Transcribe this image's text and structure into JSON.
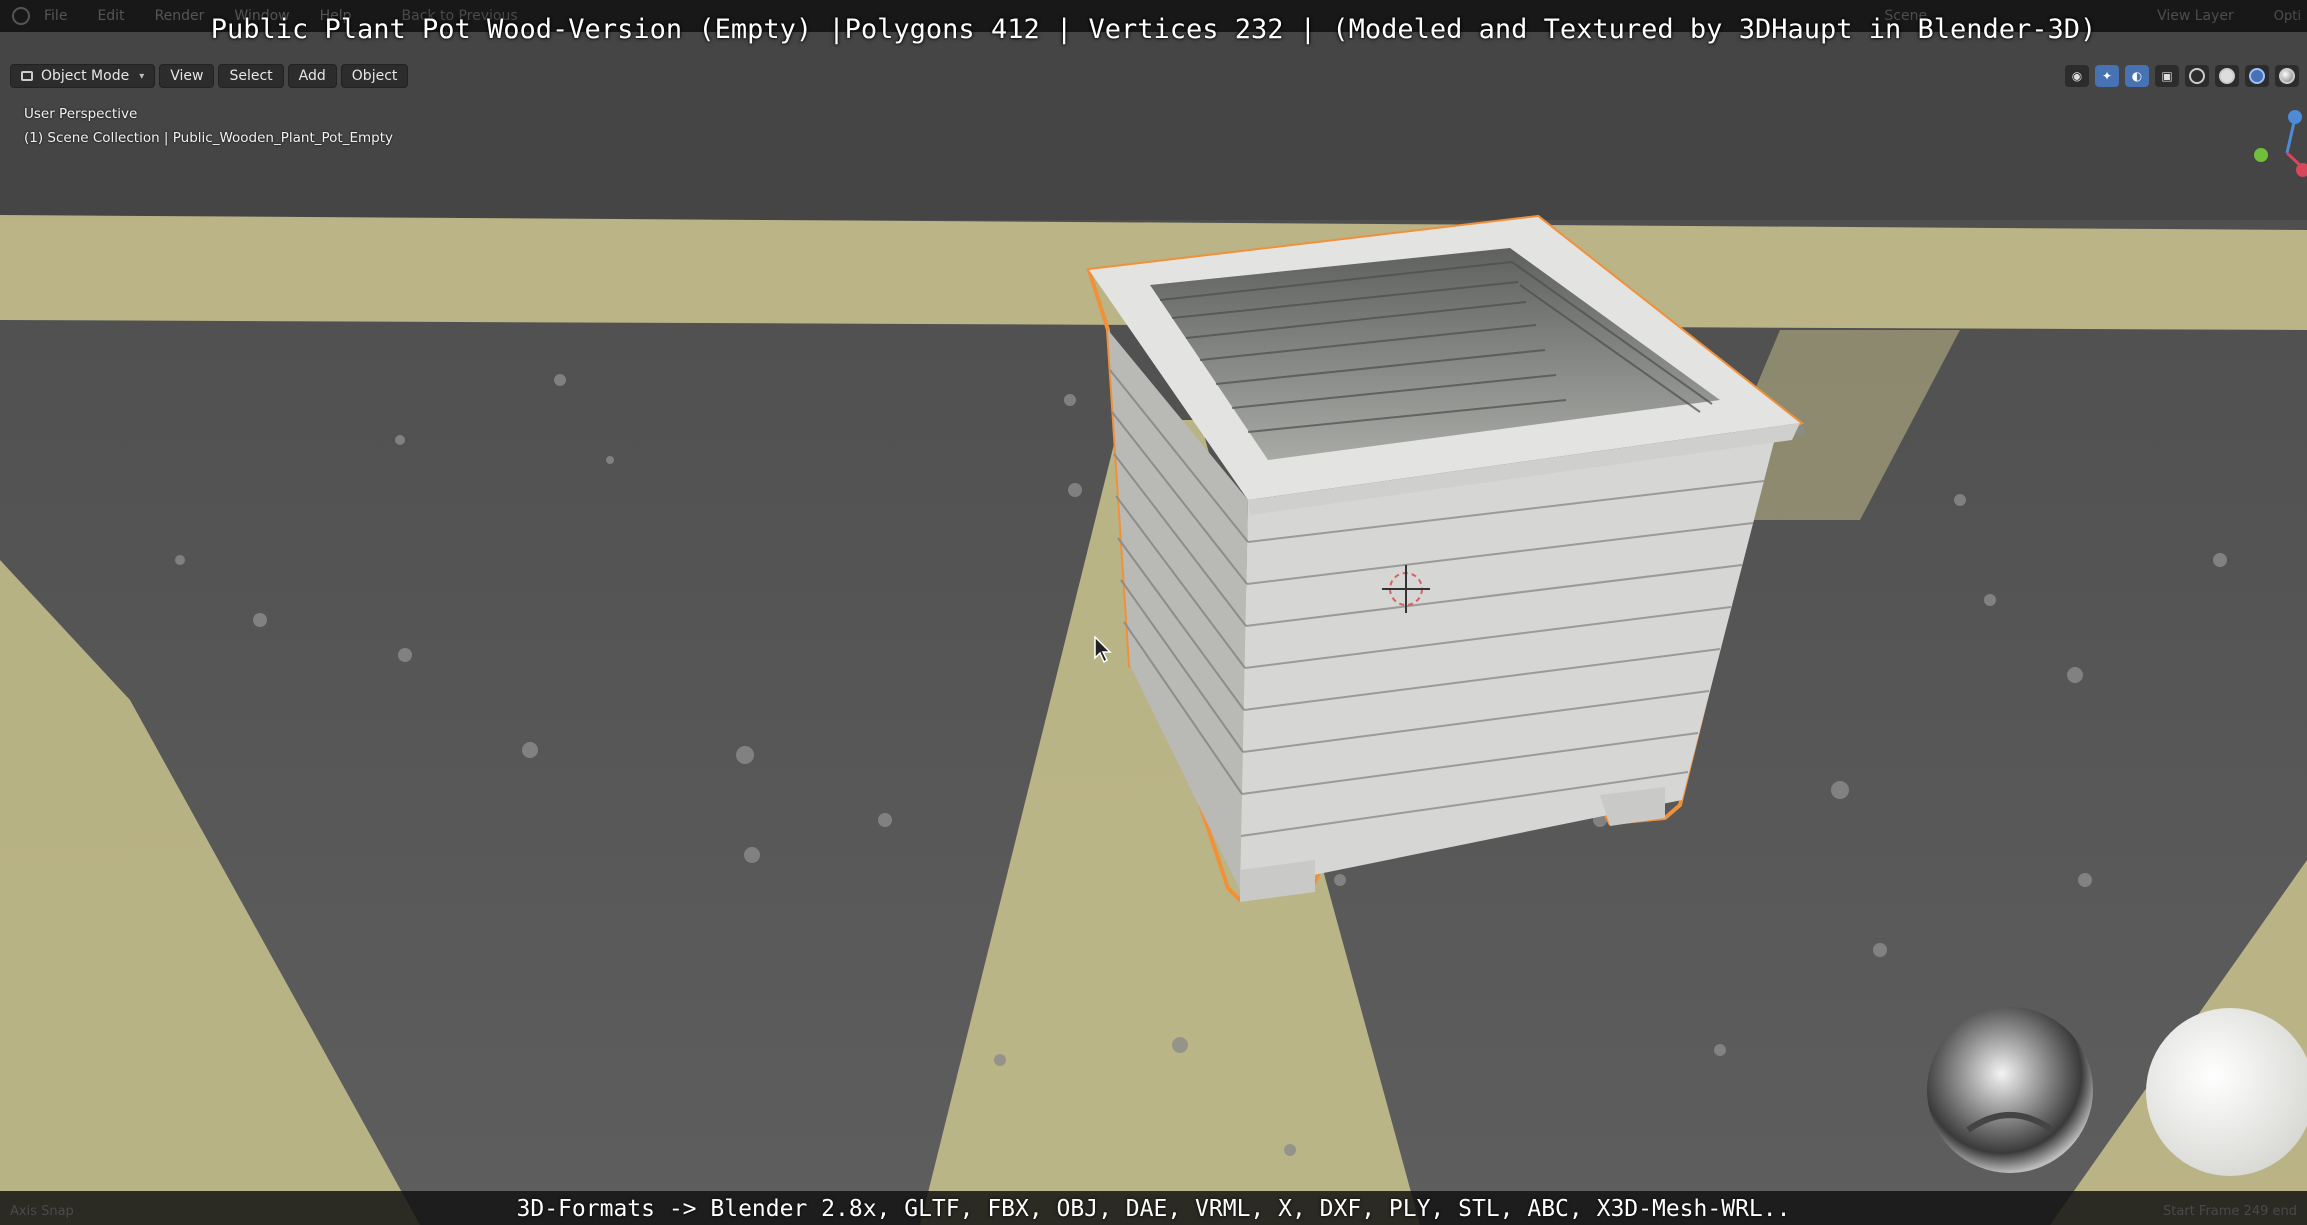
{
  "menubar": {
    "items": [
      "File",
      "Edit",
      "Render",
      "Window",
      "Help"
    ],
    "back_label": "Back to Previous",
    "scene_label": "Scene",
    "view_layer_label": "View Layer",
    "options_label": "Opti"
  },
  "overlay": {
    "title": "Public Plant Pot Wood-Version (Empty) |Polygons 412 | Vertices 232 | (Modeled and Textured by 3DHaupt in Blender-3D)",
    "caption": "3D-Formats -> Blender 2.8x, GLTF, FBX, OBJ, DAE, VRML, X, DXF, PLY, STL, ABC, X3D-Mesh-WRL.."
  },
  "header": {
    "mode": "Object Mode",
    "view": "View",
    "select": "Select",
    "add": "Add",
    "object": "Object"
  },
  "viewport_info": {
    "perspective": "User Perspective",
    "collection": "(1) Scene Collection | Public_Wooden_Plant_Pot_Empty"
  },
  "statusbar": {
    "left": "Axis Snap",
    "right": "Start Frame 249 end"
  },
  "colors": {
    "selection_outline": "#f0913a",
    "ground_yellow": "#c7c08a",
    "ground_gray": "#5a5a5a",
    "pot_white": "#d8d8d6"
  },
  "icons": [
    "blender-logo-icon",
    "cursor-icon",
    "3d-cursor-icon",
    "navigation-gizmo-icon",
    "matcap-sphere-icon"
  ]
}
